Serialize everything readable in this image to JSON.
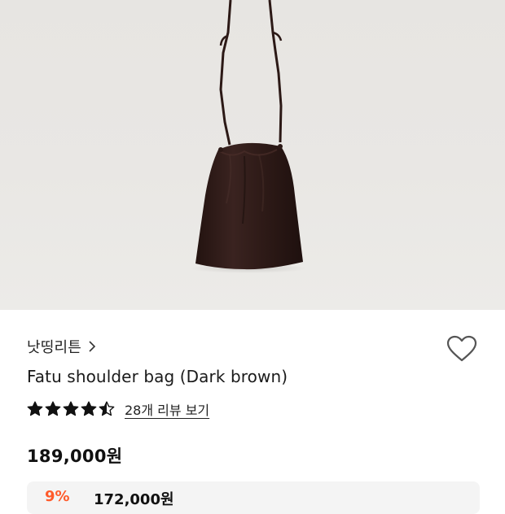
{
  "product": {
    "brand": "낫띵리튼",
    "title": "Fatu shoulder bag (Dark brown)",
    "rating": 4.5,
    "review_link": "28개 리뷰 보기",
    "price": "189,000원",
    "coupon_discount": "9%",
    "coupon_price": "172,000원"
  },
  "icons": {
    "brand_chevron": "chevron-right-icon",
    "wishlist": "heart-outline-icon",
    "star": "star-icon"
  },
  "colors": {
    "star": "#111111",
    "discount": "#ff5a2a",
    "bag": "#2e1a17"
  }
}
